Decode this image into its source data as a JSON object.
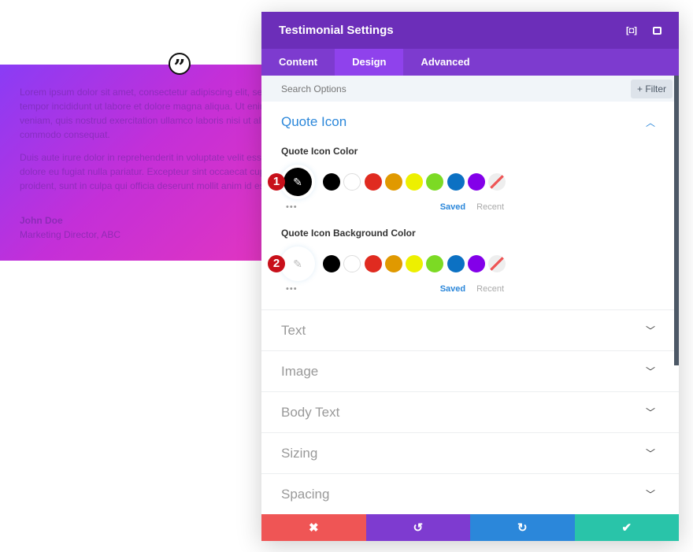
{
  "testimonial": {
    "quote_icon": "quote-icon",
    "paragraphs": [
      "Lorem ipsum dolor sit amet, consectetur adipiscing elit, sed do eiusmod",
      "tempor incididunt ut labore et dolore magna aliqua. Ut enim ad minim",
      "veniam, quis nostrud exercitation ullamco laboris nisi ut aliquip ex ea",
      "commodo consequat.",
      "Duis aute irure dolor in reprehenderit in voluptate velit esse cillum",
      "dolore eu fugiat nulla pariatur. Excepteur sint occaecat cupidatat non",
      "proident, sunt in culpa qui officia deserunt mollit anim id est laborum."
    ],
    "author": "John Doe",
    "position": "Marketing Director, ABC"
  },
  "panel": {
    "title": "Testimonial Settings",
    "tabs": [
      "Content",
      "Design",
      "Advanced"
    ],
    "active_tab": "Design",
    "search_placeholder": "Search Options",
    "filter_label": "+ Filter",
    "open_section": {
      "title": "Quote Icon",
      "fields": [
        {
          "label": "Quote Icon Color",
          "badge": "1",
          "value": "#000000"
        },
        {
          "label": "Quote Icon Background Color",
          "badge": "2",
          "value": ""
        }
      ]
    },
    "swatches": [
      "#000000",
      "#ffffff",
      "#e02b20",
      "#e09900",
      "#edf000",
      "#7cda24",
      "#0c71c3",
      "#8300e9"
    ],
    "saved_label": "Saved",
    "recent_label": "Recent",
    "sections": [
      "Text",
      "Image",
      "Body Text",
      "Sizing",
      "Spacing"
    ],
    "footer": {
      "colors": [
        "#ef5555",
        "#7e3bd0",
        "#2b87da",
        "#29c4a9"
      ]
    }
  }
}
